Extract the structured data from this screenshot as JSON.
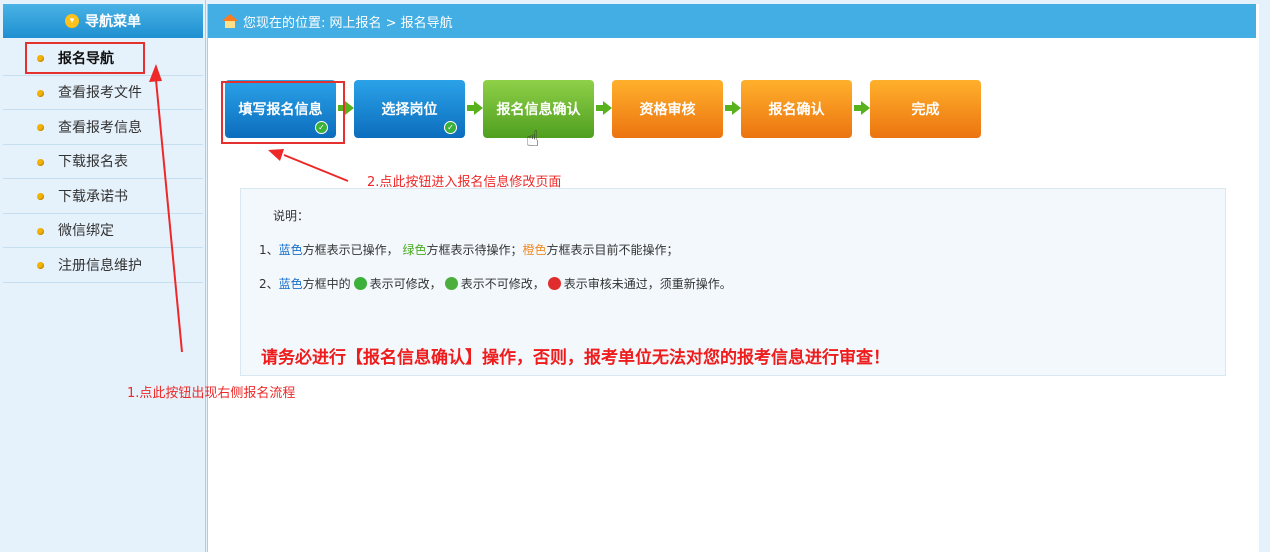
{
  "sidebar": {
    "title": "导航菜单",
    "items": [
      {
        "label": "报名导航"
      },
      {
        "label": "查看报考文件"
      },
      {
        "label": "查看报考信息"
      },
      {
        "label": "下载报名表"
      },
      {
        "label": "下载承诺书"
      },
      {
        "label": "微信绑定"
      },
      {
        "label": "注册信息维护"
      }
    ]
  },
  "breadcrumb": {
    "text": "您现在的位置: 网上报名 > 报名导航"
  },
  "steps": [
    {
      "label": "填写报名信息",
      "color": "#1a85d6",
      "state": "done"
    },
    {
      "label": "选择岗位",
      "color": "#1a85d6",
      "state": "done"
    },
    {
      "label": "报名信息确认",
      "color": "#6cbf2e",
      "state": "pending"
    },
    {
      "label": "资格审核",
      "color": "#f58c1c",
      "state": "locked"
    },
    {
      "label": "报名确认",
      "color": "#f58c1c",
      "state": "locked"
    },
    {
      "label": "完成",
      "color": "#f58c1c",
      "state": "locked"
    }
  ],
  "notes": {
    "title": "说明：",
    "line1": {
      "prefix": "1、",
      "blue": "蓝色",
      "blue_text": "方框表示已操作，",
      "green": "绿色",
      "green_text": "方框表示待操作；",
      "orange": "橙色",
      "orange_text": "方框表示目前不能操作；"
    },
    "line2": {
      "prefix": "2、",
      "blue": "蓝色",
      "text_a": "方框中的",
      "text_b": "表示可修改，",
      "text_c": "表示不可修改，",
      "text_d": "表示审核未通过，须重新操作。"
    },
    "warning": "请务必进行【报名信息确认】操作，否则，报考单位无法对您的报考信息进行审查！"
  },
  "annotations": {
    "a1": "1.点此按钮出现右侧报名流程",
    "a2": "2.点此按钮进入报名信息修改页面"
  },
  "colors": {
    "accent": "#42aee3",
    "annotation": "#ee2828",
    "blue": "#1a6fc9",
    "green": "#4bab21",
    "orange": "#f08a24"
  }
}
